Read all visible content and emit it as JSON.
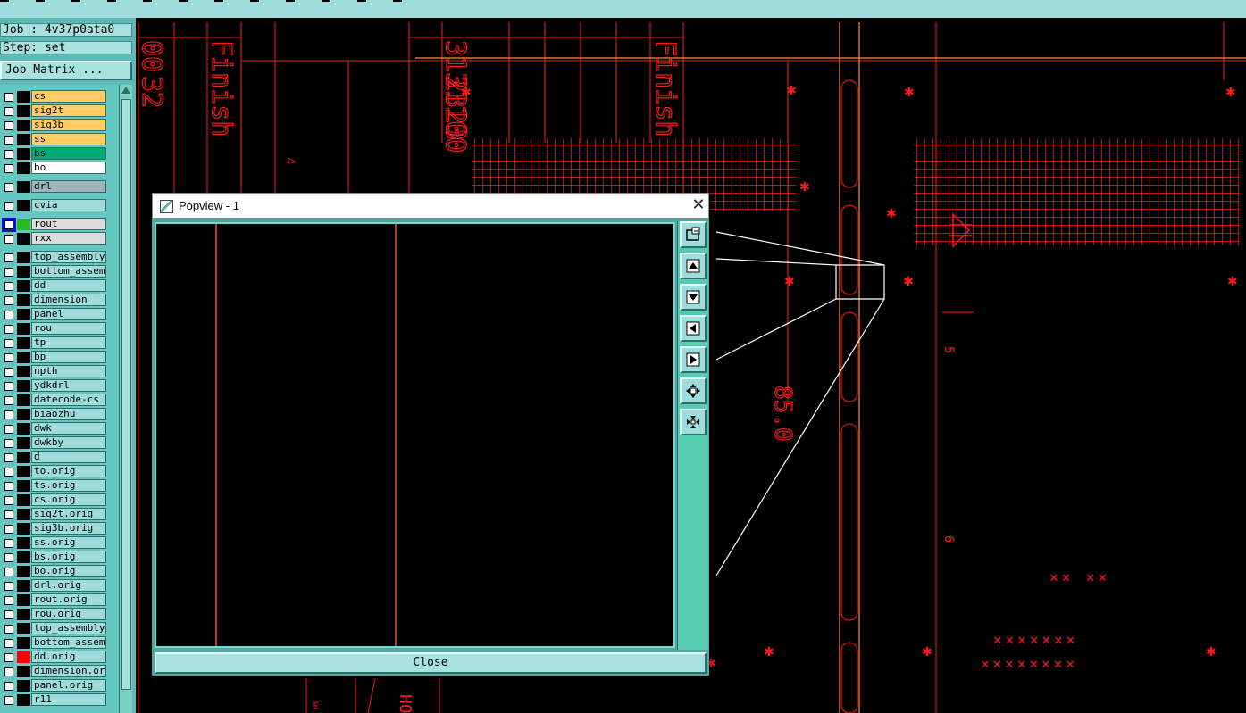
{
  "job_info": {
    "job": "Job : 4v37p0ata0",
    "step": "Step: set"
  },
  "job_matrix_button": "Job Matrix ...",
  "layers": [
    {
      "name": "cs",
      "color": "#ffcc66"
    },
    {
      "name": "sig2t",
      "color": "#ffcc66"
    },
    {
      "name": "sig3b",
      "color": "#ffcc66"
    },
    {
      "name": "ss",
      "color": "#ffcc66"
    },
    {
      "name": "bs",
      "color": "#00aa77"
    },
    {
      "name": "bo",
      "color": "#ffffff"
    },
    {
      "name": "drl",
      "color": "#a0b4bc"
    },
    {
      "name": "cvia",
      "color": "#9fdcdc"
    },
    {
      "name": "rout",
      "color": "#dcdcdc",
      "swatch": "#2ab82a",
      "checkbox_color": "#1010c8"
    },
    {
      "name": "rxx",
      "color": "#dcdcdc"
    },
    {
      "name": "top_assembly",
      "color": "#9fdcdc"
    },
    {
      "name": "bottom_assembly",
      "color": "#9fdcdc"
    },
    {
      "name": "dd",
      "color": "#9fdcdc"
    },
    {
      "name": "dimension",
      "color": "#9fdcdc"
    },
    {
      "name": "panel",
      "color": "#9fdcdc"
    },
    {
      "name": "rou",
      "color": "#9fdcdc"
    },
    {
      "name": "tp",
      "color": "#9fdcdc"
    },
    {
      "name": "bp",
      "color": "#9fdcdc"
    },
    {
      "name": "npth",
      "color": "#9fdcdc"
    },
    {
      "name": "ydkdrl",
      "color": "#9fdcdc"
    },
    {
      "name": "datecode-cs",
      "color": "#9fdcdc"
    },
    {
      "name": "biaozhu",
      "color": "#9fdcdc"
    },
    {
      "name": "dwk",
      "color": "#9fdcdc"
    },
    {
      "name": "dwkby",
      "color": "#9fdcdc"
    },
    {
      "name": "d",
      "color": "#9fdcdc"
    },
    {
      "name": "to.orig",
      "color": "#9fdcdc"
    },
    {
      "name": "ts.orig",
      "color": "#9fdcdc"
    },
    {
      "name": "cs.orig",
      "color": "#9fdcdc"
    },
    {
      "name": "sig2t.orig",
      "color": "#9fdcdc"
    },
    {
      "name": "sig3b.orig",
      "color": "#9fdcdc"
    },
    {
      "name": "ss.orig",
      "color": "#9fdcdc"
    },
    {
      "name": "bs.orig",
      "color": "#9fdcdc"
    },
    {
      "name": "bo.orig",
      "color": "#9fdcdc"
    },
    {
      "name": "drl.orig",
      "color": "#9fdcdc"
    },
    {
      "name": "rout.orig",
      "color": "#9fdcdc"
    },
    {
      "name": "rou.orig",
      "color": "#9fdcdc"
    },
    {
      "name": "top_assembly",
      "color": "#9fdcdc"
    },
    {
      "name": "bottom_assembly",
      "color": "#9fdcdc"
    },
    {
      "name": "dd.orig",
      "color": "#9fdcdc",
      "swatch": "#ff0000"
    },
    {
      "name": "dimension.orig",
      "color": "#9fdcdc"
    },
    {
      "name": "panel.orig",
      "color": "#9fdcdc"
    },
    {
      "name": "r11",
      "color": "#9fdcdc"
    }
  ],
  "popview": {
    "title": "Popview - 1",
    "close_label": "Close",
    "tool_icons": [
      "zoom-window-icon",
      "pan-up-icon",
      "pan-down-icon",
      "pan-left-icon",
      "pan-right-icon",
      "zoom-in-icon",
      "zoom-out-icon"
    ]
  },
  "cad_labels": {
    "finish": "Finish",
    "dimension": "85.0",
    "five": "5",
    "six": "6",
    "four": "4",
    "nums_a": "00",
    "nums_b": "32",
    "nums_c": "3131100",
    "nums_d": "2323",
    "frag_a": "SH",
    "frag_b": "H0"
  },
  "colors": {
    "cad_red": "#ff1a1a",
    "cad_orange": "#ff8c3a",
    "panel_teal": "#9fdcdc"
  }
}
